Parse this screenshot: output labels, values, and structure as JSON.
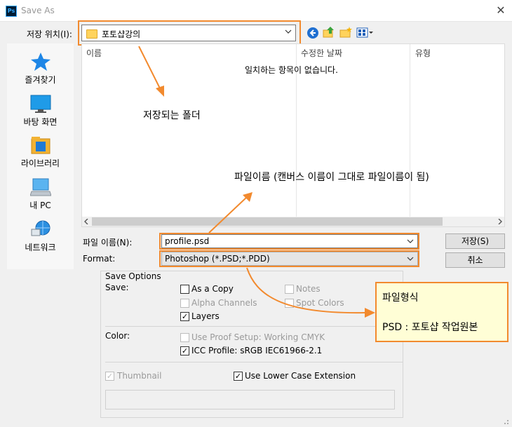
{
  "window": {
    "title": "Save As",
    "app_icon": "Ps",
    "close_glyph": "✕"
  },
  "location": {
    "label": "저장 위치(I):",
    "value": "포토샵강의"
  },
  "places": [
    {
      "label": "즐겨찾기",
      "icon": "star-icon"
    },
    {
      "label": "바탕 화면",
      "icon": "desktop-icon"
    },
    {
      "label": "라이브러리",
      "icon": "library-icon"
    },
    {
      "label": "내 PC",
      "icon": "pc-icon"
    },
    {
      "label": "네트워크",
      "icon": "network-icon"
    }
  ],
  "filelist": {
    "columns": [
      "이름",
      "수정한 날짜",
      "유형"
    ],
    "empty_message": "일치하는 항목이 없습니다."
  },
  "filename": {
    "label": "파일 이름(N):",
    "value": "profile.psd"
  },
  "format": {
    "label": "Format:",
    "value": "Photoshop (*.PSD;*.PDD)"
  },
  "buttons": {
    "save": "저장(S)",
    "cancel": "취소"
  },
  "save_options": {
    "heading": "Save Options",
    "save_label": "Save:",
    "as_copy": {
      "label": "As a Copy",
      "checked": false,
      "enabled": true
    },
    "notes": {
      "label": "Notes",
      "checked": false,
      "enabled": false
    },
    "alpha_channels": {
      "label": "Alpha Channels",
      "checked": false,
      "enabled": false
    },
    "spot_colors": {
      "label": "Spot Colors",
      "checked": false,
      "enabled": false
    },
    "layers": {
      "label": "Layers",
      "checked": true,
      "enabled": true
    },
    "color_label": "Color:",
    "use_proof": {
      "label": "Use Proof Setup:  Working CMYK",
      "checked": false,
      "enabled": false
    },
    "icc_profile": {
      "label": "ICC Profile:  sRGB IEC61966-2.1",
      "checked": true,
      "enabled": true
    },
    "thumbnail": {
      "label": "Thumbnail",
      "checked": true,
      "enabled": false
    },
    "lower_case": {
      "label": "Use Lower Case Extension",
      "checked": true,
      "enabled": true
    }
  },
  "annotations": {
    "folder_note": "저장되는 폴더",
    "filename_note": "파일이름 (캔버스 이름이 그대로 파일이름이 됨)",
    "format_title": "파일형식",
    "format_desc": "PSD : 포토샵 작업원본"
  },
  "colors": {
    "annotation_orange": "#f28a2e",
    "note_bg": "#fffed6"
  }
}
